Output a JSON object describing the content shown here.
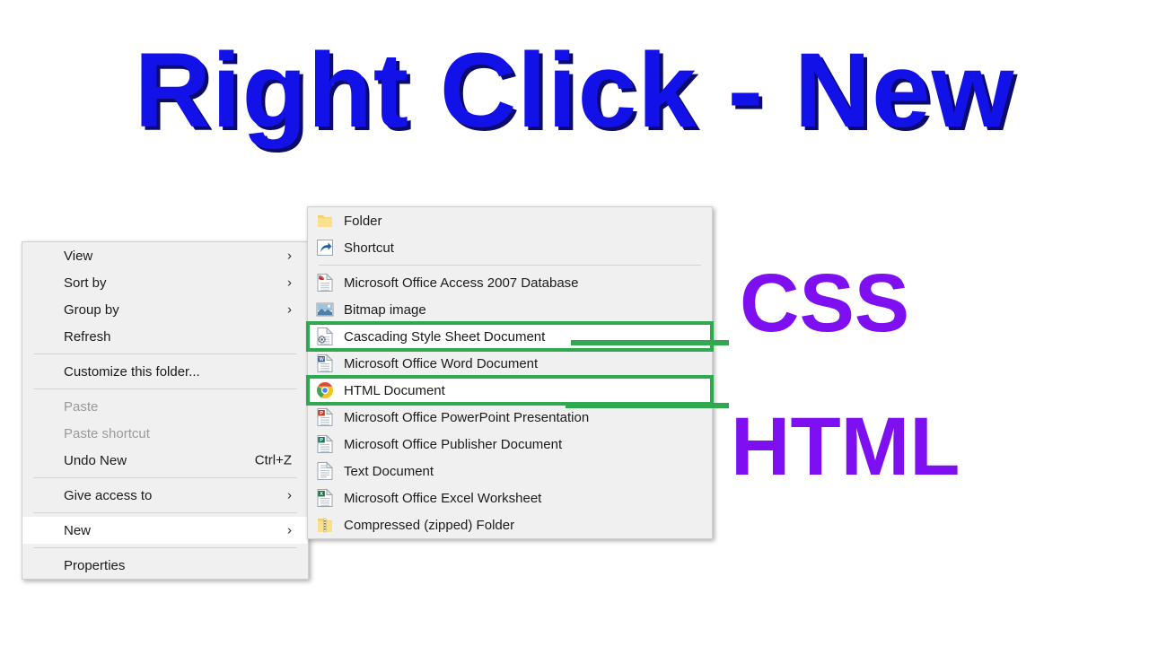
{
  "banner": {
    "title": "Right Click - New",
    "title_color": "#1212E8",
    "shadow_color": "#0B0B6E"
  },
  "side_labels": {
    "css": "CSS",
    "html": "HTML",
    "color": "#7D0FF0"
  },
  "annotation": {
    "highlight_color": "#2FA84F",
    "highlighted_items": [
      "Cascading Style Sheet Document",
      "HTML Document"
    ]
  },
  "context_menu": {
    "name": "desktop-context-menu",
    "items": [
      {
        "label": "View",
        "type": "submenu",
        "disabled": false,
        "selected": false,
        "accel": ""
      },
      {
        "label": "Sort by",
        "type": "submenu",
        "disabled": false,
        "selected": false,
        "accel": ""
      },
      {
        "label": "Group by",
        "type": "submenu",
        "disabled": false,
        "selected": false,
        "accel": ""
      },
      {
        "label": "Refresh",
        "type": "item",
        "disabled": false,
        "selected": false,
        "accel": ""
      },
      {
        "type": "separator"
      },
      {
        "label": "Customize this folder...",
        "type": "item",
        "disabled": false,
        "selected": false,
        "accel": ""
      },
      {
        "type": "separator"
      },
      {
        "label": "Paste",
        "type": "item",
        "disabled": true,
        "selected": false,
        "accel": ""
      },
      {
        "label": "Paste shortcut",
        "type": "item",
        "disabled": true,
        "selected": false,
        "accel": ""
      },
      {
        "label": "Undo New",
        "type": "item",
        "disabled": false,
        "selected": false,
        "accel": "Ctrl+Z"
      },
      {
        "type": "separator"
      },
      {
        "label": "Give access to",
        "type": "submenu",
        "disabled": false,
        "selected": false,
        "accel": ""
      },
      {
        "type": "separator"
      },
      {
        "label": "New",
        "type": "submenu",
        "disabled": false,
        "selected": true,
        "accel": ""
      },
      {
        "type": "separator"
      },
      {
        "label": "Properties",
        "type": "item",
        "disabled": false,
        "selected": false,
        "accel": ""
      }
    ]
  },
  "new_submenu": {
    "name": "new-submenu",
    "items": [
      {
        "label": "Folder",
        "icon": "folder-icon",
        "highlighted": false
      },
      {
        "label": "Shortcut",
        "icon": "shortcut-icon",
        "highlighted": false
      },
      {
        "type": "separator"
      },
      {
        "label": "Microsoft Office Access 2007 Database",
        "icon": "access-file-icon",
        "highlighted": false
      },
      {
        "label": "Bitmap image",
        "icon": "bitmap-image-icon",
        "highlighted": false
      },
      {
        "label": "Cascading Style Sheet Document",
        "icon": "css-file-icon",
        "highlighted": true
      },
      {
        "label": "Microsoft Office Word Document",
        "icon": "word-file-icon",
        "highlighted": false
      },
      {
        "label": "HTML Document",
        "icon": "chrome-html-icon",
        "highlighted": true
      },
      {
        "label": "Microsoft Office PowerPoint Presentation",
        "icon": "powerpoint-file-icon",
        "highlighted": false
      },
      {
        "label": "Microsoft Office Publisher Document",
        "icon": "publisher-file-icon",
        "highlighted": false
      },
      {
        "label": "Text Document",
        "icon": "text-file-icon",
        "highlighted": false
      },
      {
        "label": "Microsoft Office Excel Worksheet",
        "icon": "excel-file-icon",
        "highlighted": false
      },
      {
        "label": "Compressed (zipped) Folder",
        "icon": "zip-folder-icon",
        "highlighted": false
      }
    ]
  }
}
